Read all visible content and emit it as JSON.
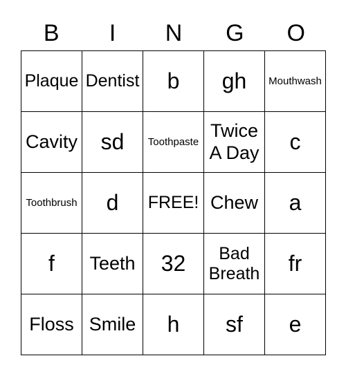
{
  "header": [
    "B",
    "I",
    "N",
    "G",
    "O"
  ],
  "cells": [
    [
      "Plaque",
      "Dentist",
      "b",
      "gh",
      "Mouthwash"
    ],
    [
      "Cavity",
      "sd",
      "Toothpaste",
      "Twice A Day",
      "c"
    ],
    [
      "Toothbrush",
      "d",
      "FREE!",
      "Chew",
      "a"
    ],
    [
      "f",
      "Teeth",
      "32",
      "Bad Breath",
      "fr"
    ],
    [
      "Floss",
      "Smile",
      "h",
      "sf",
      "e"
    ]
  ]
}
